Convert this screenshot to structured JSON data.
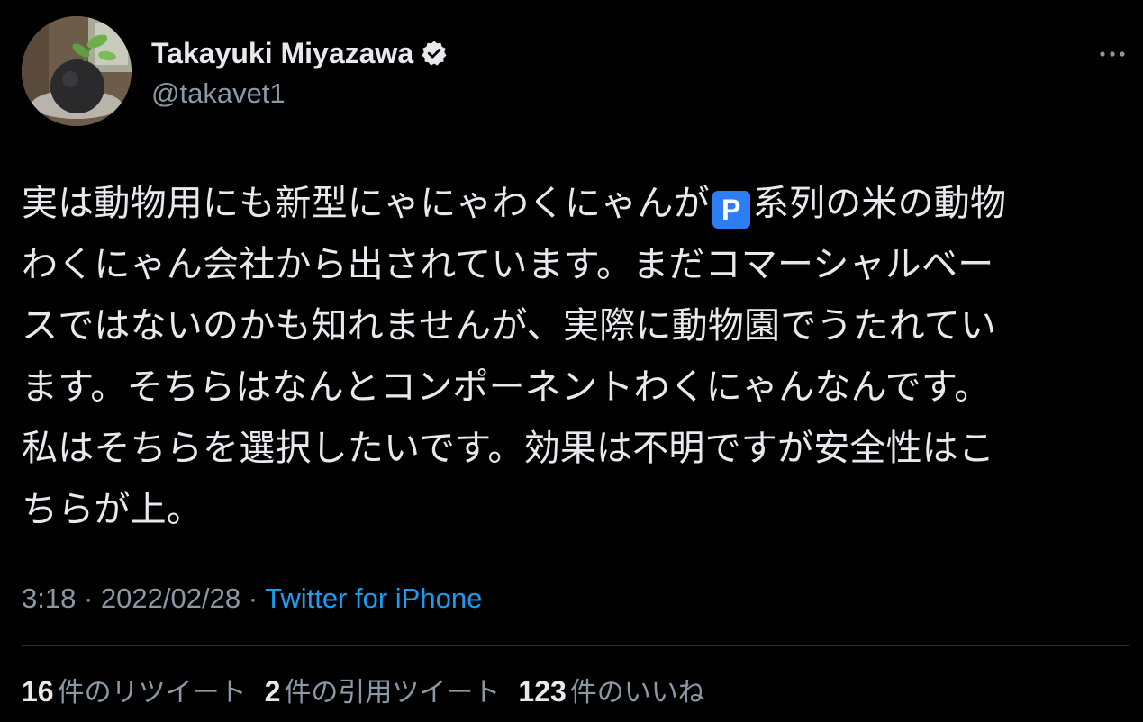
{
  "tweet": {
    "author": {
      "display_name": "Takayuki Miyazawa",
      "handle": "@takavet1",
      "verified": true
    },
    "text_before_badge": "実は動物用にも新型にゃにゃわくにゃんが",
    "badge_symbol": "P",
    "text_after_badge": "系列の米の動物\nわくにゃん会社から出されています。まだコマーシャルベー\nスではないのかも知れませんが、実際に動物園でうたれてい\nます。そちらはなんとコンポーネントわくにゃんなんです。\n私はそちらを選択したいです。効果は不明ですが安全性はこ\nちらが上。",
    "time": "3:18",
    "date": "2022/02/28",
    "separator": "·",
    "source": "Twitter for iPhone"
  },
  "stats": {
    "retweets": {
      "count": "16",
      "label": "件のリツイート"
    },
    "quotes": {
      "count": "2",
      "label": "件の引用ツイート"
    },
    "likes": {
      "count": "123",
      "label": "件のいいね"
    }
  },
  "icons": {
    "verified": "verified-badge-icon",
    "more": "more-options-icon",
    "badge": "p-button-emoji"
  },
  "colors": {
    "background": "#000000",
    "text_primary": "#e7e9ea",
    "text_secondary": "#8b98a5",
    "link": "#1d9bf0",
    "divider": "#2f3336",
    "emoji_badge": "#2b7ff2"
  }
}
